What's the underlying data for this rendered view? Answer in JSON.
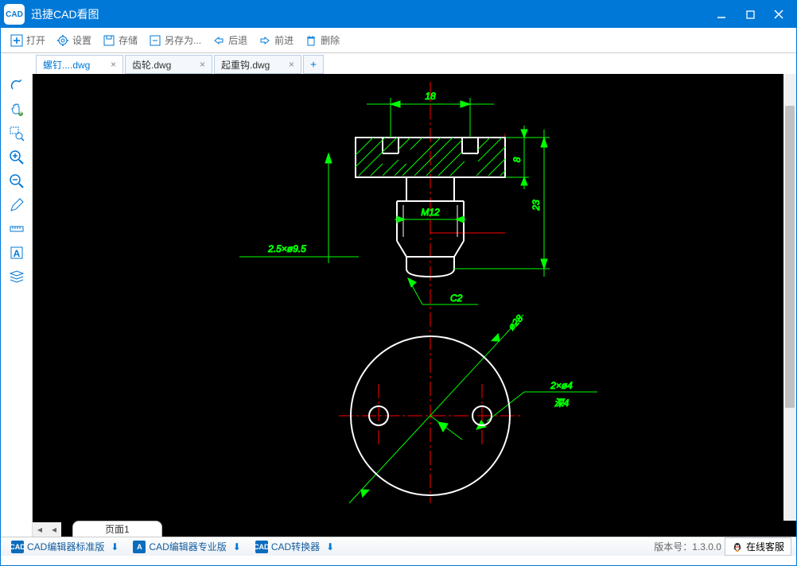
{
  "app": {
    "title": "迅捷CAD看图",
    "logo": "CAD"
  },
  "toolbar": {
    "open": "打开",
    "settings": "设置",
    "save": "存储",
    "saveas": "另存为...",
    "back": "后退",
    "forward": "前进",
    "delete": "删除"
  },
  "tabs": [
    {
      "label": "螺钉....dwg",
      "active": true
    },
    {
      "label": "齿轮.dwg",
      "active": false
    },
    {
      "label": "起重钩.dwg",
      "active": false
    }
  ],
  "page_tab": "页面1",
  "status": {
    "editor_std": "CAD编辑器标准版",
    "editor_pro": "CAD编辑器专业版",
    "converter": "CAD转换器",
    "version_label": "版本号：",
    "version": "1.3.0.0",
    "support": "在线客服"
  },
  "drawing": {
    "dim_18": "18",
    "dim_8": "8",
    "dim_23": "23",
    "dim_m12": "M12",
    "note1": "2.5×ø9.5",
    "note_c2": "C2",
    "note_phi28": "ø28",
    "note_2x4": "2×ø4",
    "note_depth": "深4"
  }
}
